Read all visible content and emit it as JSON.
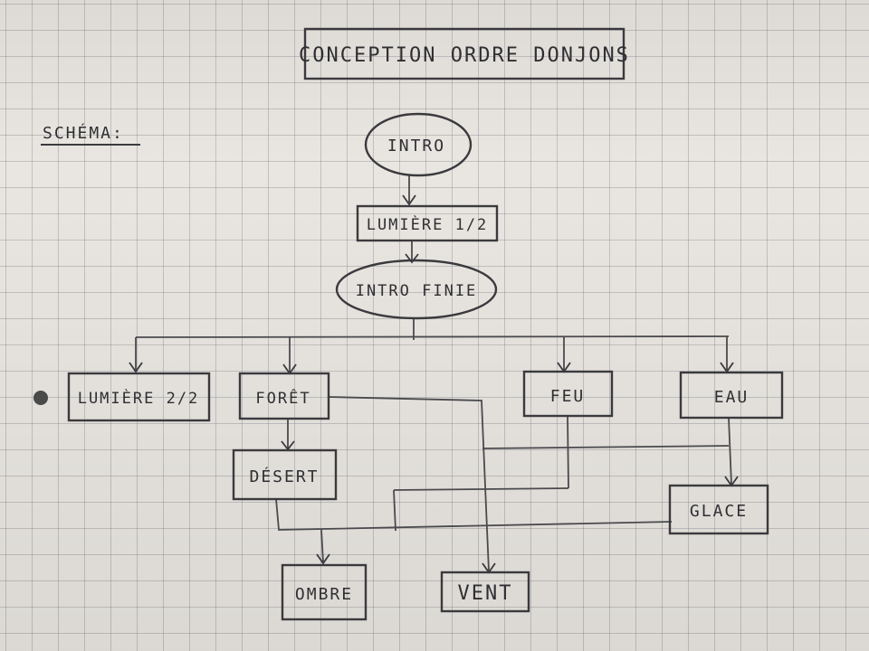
{
  "title": "CONCEPTION ORDRE DONJONS",
  "section_label": "SCHÉMA:",
  "nodes": {
    "intro": "INTRO",
    "lumiere_1": "LUMIÈRE 1/2",
    "intro_finie": "INTRO FINIE",
    "lumiere_2": "LUMIÈRE 2/2",
    "foret": "FORÊT",
    "feu": "FEU",
    "eau": "EAU",
    "desert": "DÉSERT",
    "glace": "GLACE",
    "ombre": "OMBRE",
    "vent": "VENT"
  },
  "colors": {
    "paper": "#e9e6e1",
    "ink": "#2f2f33"
  }
}
